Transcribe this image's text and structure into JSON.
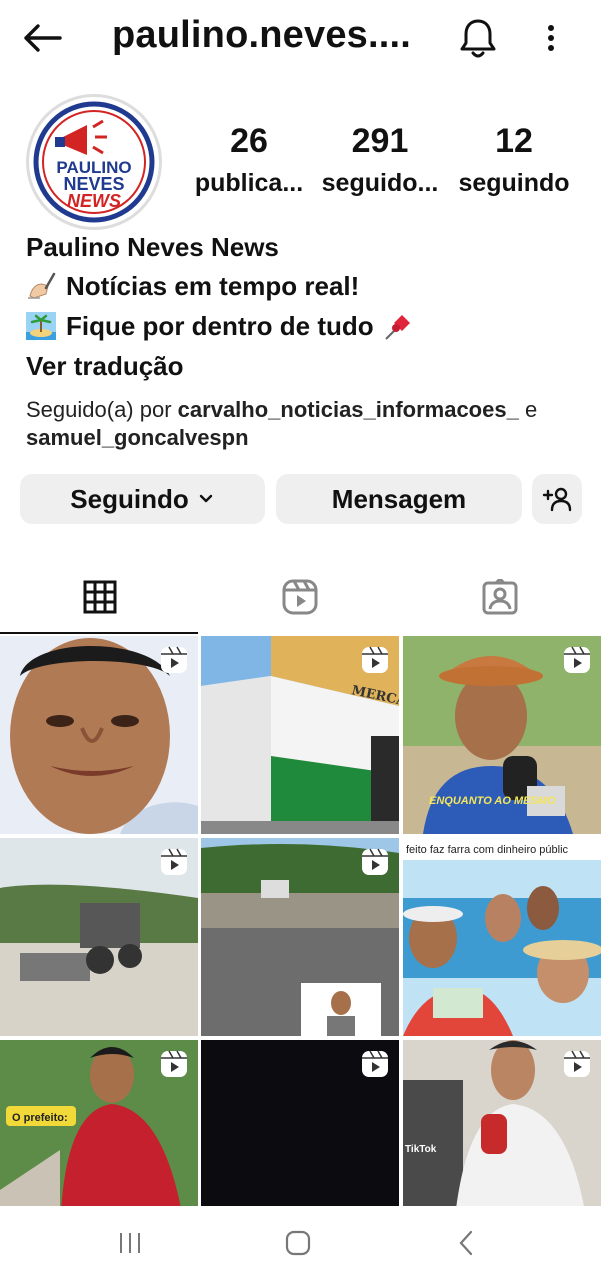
{
  "header": {
    "username": "paulino.neves....",
    "back_icon": "arrow-left-icon",
    "bell_icon": "bell-icon",
    "more_icon": "more-vertical-icon"
  },
  "profile": {
    "avatar_text": [
      "PAULINO",
      "NEVES",
      "NEWS"
    ],
    "stats": [
      {
        "value": "26",
        "label": "publica..."
      },
      {
        "value": "291",
        "label": "seguido..."
      },
      {
        "value": "12",
        "label": "seguindo"
      }
    ],
    "name": "Paulino Neves News",
    "bio_lines": [
      {
        "icon": "writing-hand-emoji",
        "text": "Notícias em tempo real!"
      },
      {
        "icon": "island-emoji",
        "text": "Fique por dentro de tudo",
        "trailing_icon": "pushpin-emoji"
      }
    ],
    "translate_label": "Ver tradução",
    "followed_by_prefix": "Seguido(a) por",
    "followed_by_user1": "carvalho_noticias_informacoes_",
    "followed_by_and": "e",
    "followed_by_user2": "samuel_goncalvespn"
  },
  "actions": {
    "following_label": "Seguindo",
    "message_label": "Mensagem",
    "add_user_icon": "add-user-icon"
  },
  "tabs": [
    {
      "icon": "grid-icon",
      "active": true
    },
    {
      "icon": "reels-icon",
      "active": false
    },
    {
      "icon": "tagged-icon",
      "active": false
    }
  ],
  "posts": [
    {
      "type": "reel",
      "caption": ""
    },
    {
      "type": "reel",
      "caption": "MERCADO"
    },
    {
      "type": "reel",
      "caption": "ENQUANTO AO MESMO"
    },
    {
      "type": "reel",
      "caption": ""
    },
    {
      "type": "reel",
      "caption": ""
    },
    {
      "type": "post",
      "caption": "feito faz farra com dinheiro públic"
    },
    {
      "type": "reel",
      "caption": "O prefeito:"
    },
    {
      "type": "reel",
      "caption": ""
    },
    {
      "type": "reel",
      "caption": "TikTok"
    }
  ],
  "colors": {
    "button_bg": "#efefef",
    "text": "#111111"
  }
}
